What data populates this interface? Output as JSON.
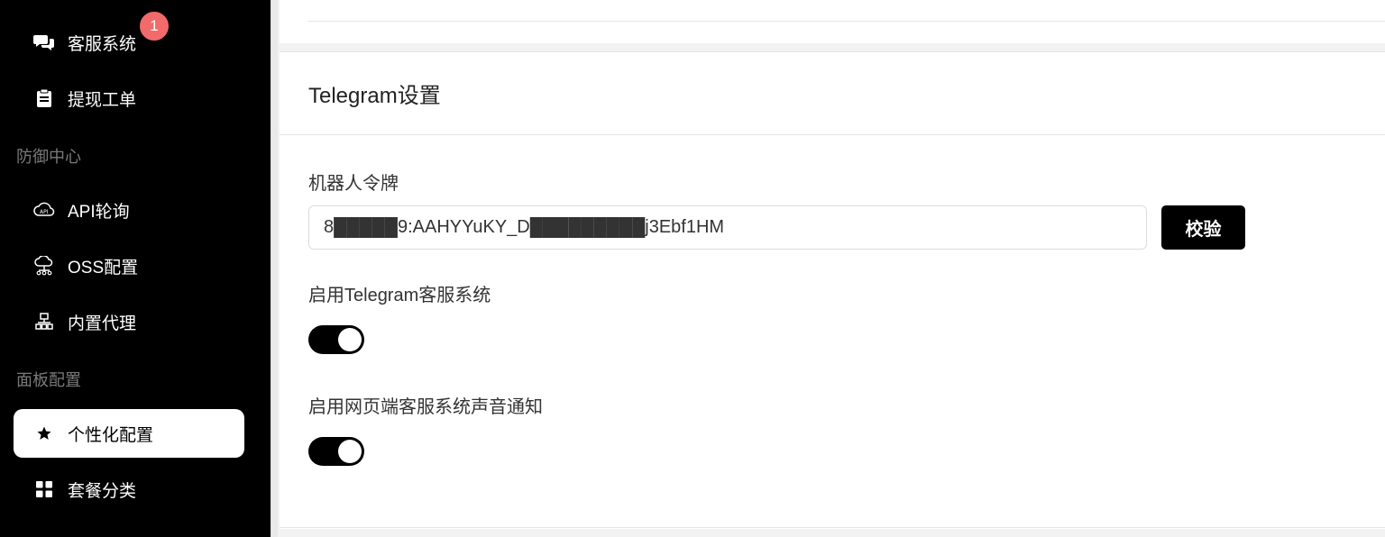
{
  "sidebar": {
    "items_top": [
      {
        "label": "客服系统",
        "icon": "chat-bubbles-icon",
        "badge": "1"
      },
      {
        "label": "提现工单",
        "icon": "clipboard-icon"
      }
    ],
    "section_defense": "防御中心",
    "items_defense": [
      {
        "label": "API轮询",
        "icon": "cloud-api-icon"
      },
      {
        "label": "OSS配置",
        "icon": "cloud-network-icon"
      },
      {
        "label": "内置代理",
        "icon": "proxy-tree-icon"
      }
    ],
    "section_panel": "面板配置",
    "items_panel": [
      {
        "label": "个性化配置",
        "icon": "star-icon",
        "active": true
      },
      {
        "label": "套餐分类",
        "icon": "grid-icon"
      }
    ]
  },
  "main": {
    "card_title": "Telegram设置",
    "token_label": "机器人令牌",
    "token_value": "8█████9:AAHYYuKY_D█████████j3Ebf1HM",
    "verify_button": "校验",
    "enable_telegram_label": "启用Telegram客服系统",
    "enable_telegram": true,
    "enable_sound_label": "启用网页端客服系统声音通知",
    "enable_sound": true
  },
  "colors": {
    "sidebar_bg": "#000000",
    "badge": "#f26a6a",
    "accent": "#000000"
  }
}
